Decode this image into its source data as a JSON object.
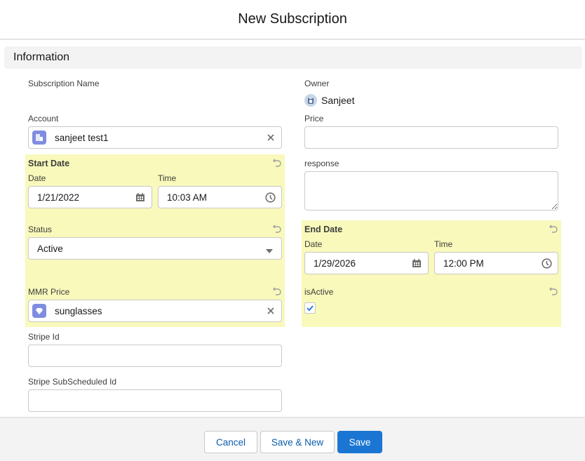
{
  "modal": {
    "title": "New Subscription"
  },
  "section": {
    "title": "Information"
  },
  "left": {
    "subscription_name": {
      "label": "Subscription Name"
    },
    "account": {
      "label": "Account",
      "value": "sanjeet test1",
      "icon": "account-icon",
      "icon_color": "#7f8de1"
    },
    "start_date": {
      "label": "Start Date",
      "date_label": "Date",
      "date_value": "1/21/2022",
      "time_label": "Time",
      "time_value": "10:03 AM"
    },
    "status": {
      "label": "Status",
      "value": "Active"
    },
    "mmr_price": {
      "label": "MMR Price",
      "value": "sunglasses",
      "icon": "product-icon",
      "icon_color": "#7f8de1"
    },
    "stripe_id": {
      "label": "Stripe Id",
      "value": ""
    },
    "stripe_subscheduled_id": {
      "label": "Stripe SubScheduled Id",
      "value": ""
    }
  },
  "right": {
    "owner": {
      "label": "Owner",
      "value": "Sanjeet"
    },
    "price": {
      "label": "Price",
      "value": ""
    },
    "response": {
      "label": "response",
      "value": ""
    },
    "end_date": {
      "label": "End Date",
      "date_label": "Date",
      "date_value": "1/29/2026",
      "time_label": "Time",
      "time_value": "12:00 PM"
    },
    "is_active": {
      "label": "isActive",
      "checked": true
    }
  },
  "footer": {
    "cancel": "Cancel",
    "save_new": "Save & New",
    "save": "Save"
  },
  "colors": {
    "highlight": "#f8f9bb",
    "brand": "#1b76d3",
    "link": "#0b5cab"
  }
}
